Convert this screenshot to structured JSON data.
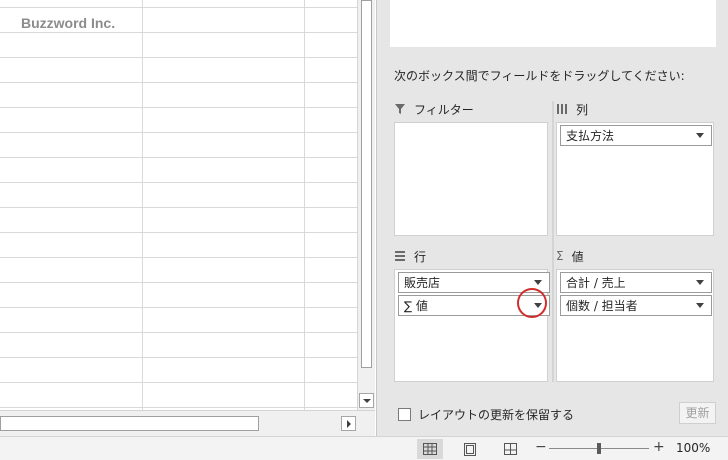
{
  "sheet": {
    "watermark": "Buzzword Inc."
  },
  "pivot_pane": {
    "instruction": "次のボックス間でフィールドをドラッグしてください:",
    "areas": {
      "filter": {
        "label": "フィルター",
        "icon": "filter-icon",
        "fields": []
      },
      "columns": {
        "label": "列",
        "icon": "columns-icon",
        "fields": [
          "支払方法"
        ]
      },
      "rows": {
        "label": "行",
        "icon": "rows-icon",
        "fields": [
          "販売店",
          "∑ 値"
        ]
      },
      "values": {
        "label": "値",
        "icon": "sigma-icon",
        "fields": [
          "合計 / 売上",
          "個数 / 担当者"
        ]
      }
    },
    "defer_update_label": "レイアウトの更新を保留する",
    "defer_update_checked": false,
    "update_button": "更新"
  },
  "status_bar": {
    "zoom": "100%",
    "zoom_minus": "−",
    "zoom_plus": "+",
    "active_view": "normal"
  },
  "colors": {
    "highlight_ring": "#d22d2d",
    "pane_bg": "#e6e6e6",
    "gridline": "#d9d9d9"
  }
}
